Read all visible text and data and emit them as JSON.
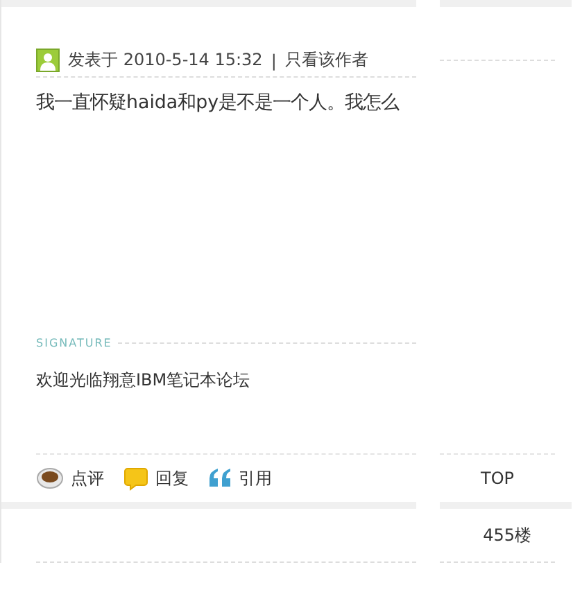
{
  "post": {
    "meta": {
      "posted": "发表于 2010-5-14 15:32",
      "separator": "|",
      "author_only": "只看该作者"
    },
    "body": "我一直怀疑haida和py是不是一个人。我怎么",
    "signature_label": "SIGNATURE",
    "signature": "欢迎光临翔意IBM笔记本论坛",
    "actions": [
      {
        "kind": "rate",
        "label": "点评"
      },
      {
        "kind": "reply",
        "label": "回复"
      },
      {
        "kind": "quote",
        "label": "引用"
      }
    ],
    "top_link": "TOP"
  },
  "next_post": {
    "floor": "455楼"
  }
}
